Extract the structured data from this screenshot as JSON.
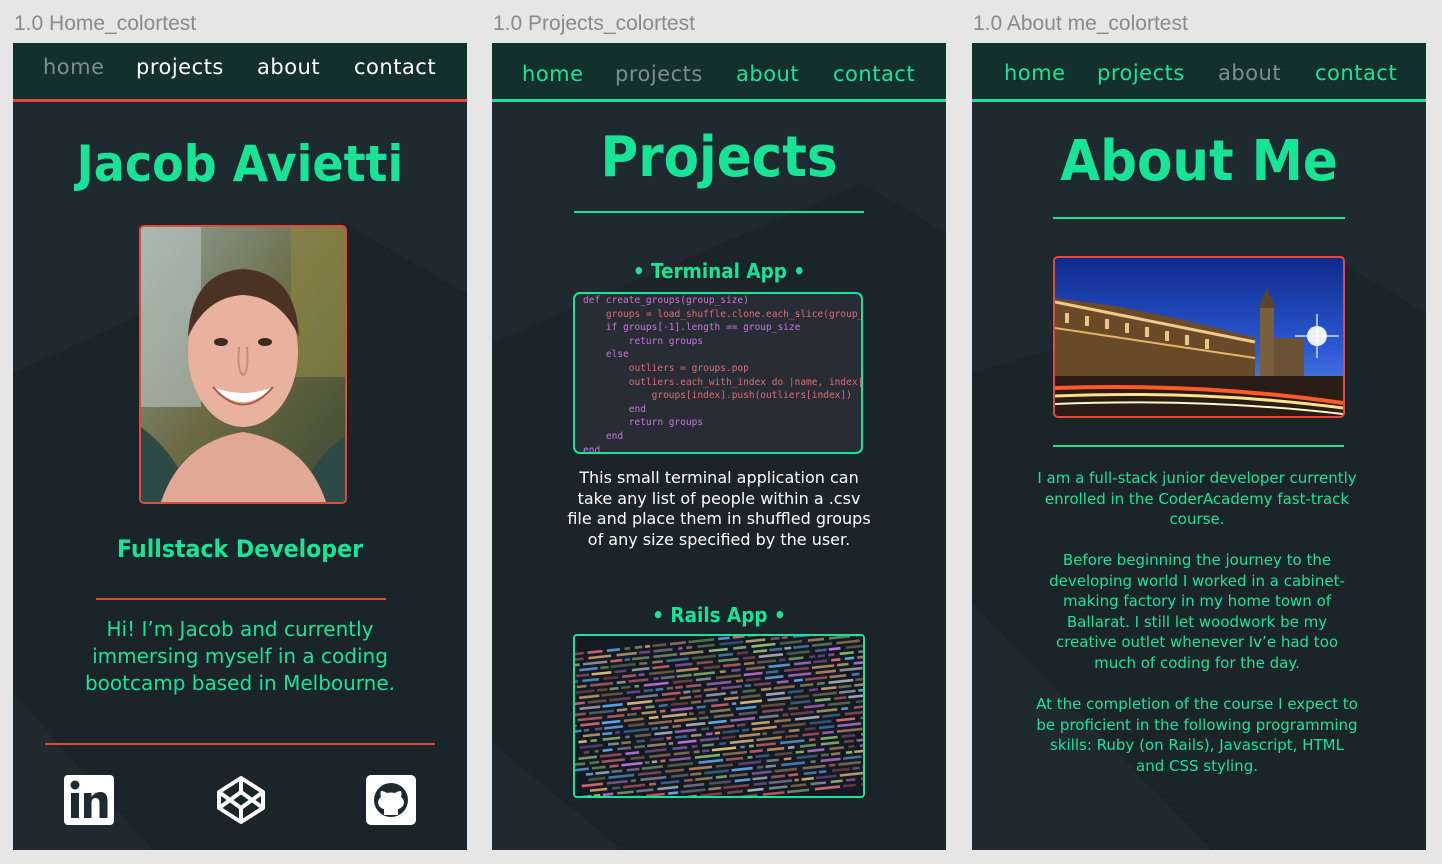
{
  "frames": {
    "home": {
      "label": "1.0 Home_colortest",
      "nav": [
        "home",
        "projects",
        "about",
        "contact"
      ],
      "name": "Jacob Avietti",
      "role": "Fullstack Developer",
      "intro": "Hi! I’m Jacob and currently immersing myself in a coding bootcamp based in Melbourne.",
      "social_icons": [
        "linkedin-icon",
        "codepen-icon",
        "github-icon"
      ]
    },
    "projects": {
      "label": "1.0 Projects_colortest",
      "nav": [
        "home",
        "projects",
        "about",
        "contact"
      ],
      "title": "Projects",
      "project1_title": "• Terminal App •",
      "project1_desc": "This small terminal application can take any list of people within a .csv file and place them in shuffled groups of any size specified by the user.",
      "project2_title": "• Rails App •",
      "code_lines": [
        "def create_groups(group_size)",
        "    groups = load_shuffle.clone.each_slice(group_size",
        "    if groups[-1].length == group_size",
        "        return groups",
        "    else",
        "        outliers = groups.pop",
        "        outliers.each_with_index do |name, index|",
        "            groups[index].push(outliers[index])",
        "        end",
        "        return groups",
        "    end",
        "end"
      ]
    },
    "about": {
      "label": "1.0 About me_colortest",
      "nav": [
        "home",
        "projects",
        "about",
        "contact"
      ],
      "title": "About Me",
      "p1": "I am a full-stack junior developer currently enrolled in the CoderAcademy fast-track course.",
      "p2": "Before beginning the journey to the developing world I worked in a cabinet-making factory in my home town of Ballarat. I still let woodwork be my creative outlet whenever Iv’e had too much of coding for the day.",
      "p3": "At the completion of the course I expect to be proficient in the following programming skills: Ruby (on Rails), Javascript, HTML and CSS styling."
    }
  },
  "colors": {
    "accent": "#18e497",
    "home_accent": "#e24a3c",
    "background": "#1e2a2f",
    "nav": "#14302d",
    "muted": "#7d8f8d"
  }
}
